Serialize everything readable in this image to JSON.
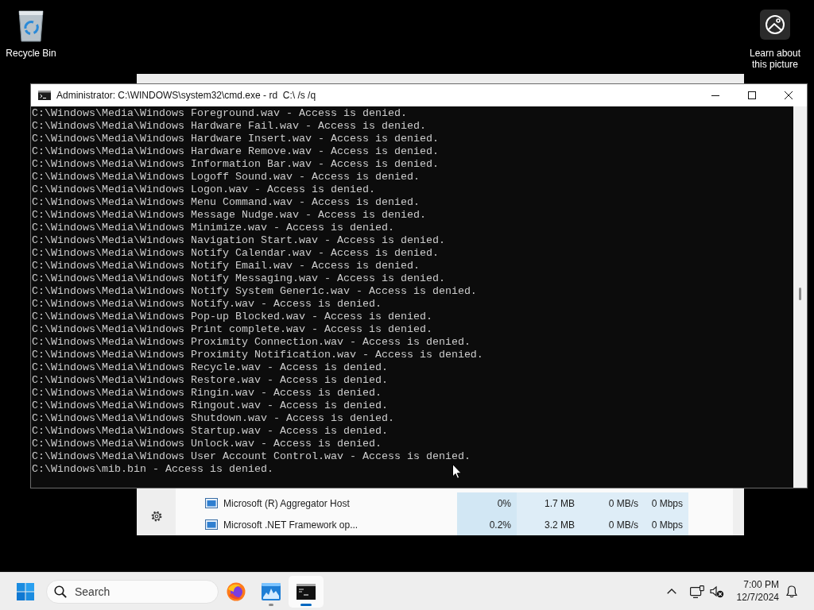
{
  "desktop_icons": [
    {
      "kind": "recycle-bin",
      "label": "Recycle Bin"
    },
    {
      "kind": "picture-info",
      "label": "Learn about this picture"
    }
  ],
  "background_window": {
    "rows": [
      {
        "cells": [
          "Microsoft (R) Aggregator Host",
          "",
          "0%",
          "1.7 MB",
          "0 MB/s",
          "0 Mbps"
        ]
      },
      {
        "cells": [
          "Microsoft .NET Framework op...",
          "",
          "0.2%",
          "3.2 MB",
          "0 MB/s",
          "0 Mbps"
        ]
      }
    ]
  },
  "console_window": {
    "title": "Administrator: C:\\WINDOWS\\system32\\cmd.exe - rd  C:\\ /s /q",
    "lines": [
      "C:\\Windows\\Media\\Windows Foreground.wav - Access is denied.",
      "C:\\Windows\\Media\\Windows Hardware Fail.wav - Access is denied.",
      "C:\\Windows\\Media\\Windows Hardware Insert.wav - Access is denied.",
      "C:\\Windows\\Media\\Windows Hardware Remove.wav - Access is denied.",
      "C:\\Windows\\Media\\Windows Information Bar.wav - Access is denied.",
      "C:\\Windows\\Media\\Windows Logoff Sound.wav - Access is denied.",
      "C:\\Windows\\Media\\Windows Logon.wav - Access is denied.",
      "C:\\Windows\\Media\\Windows Menu Command.wav - Access is denied.",
      "C:\\Windows\\Media\\Windows Message Nudge.wav - Access is denied.",
      "C:\\Windows\\Media\\Windows Minimize.wav - Access is denied.",
      "C:\\Windows\\Media\\Windows Navigation Start.wav - Access is denied.",
      "C:\\Windows\\Media\\Windows Notify Calendar.wav - Access is denied.",
      "C:\\Windows\\Media\\Windows Notify Email.wav - Access is denied.",
      "C:\\Windows\\Media\\Windows Notify Messaging.wav - Access is denied.",
      "C:\\Windows\\Media\\Windows Notify System Generic.wav - Access is denied.",
      "C:\\Windows\\Media\\Windows Notify.wav - Access is denied.",
      "C:\\Windows\\Media\\Windows Pop-up Blocked.wav - Access is denied.",
      "C:\\Windows\\Media\\Windows Print complete.wav - Access is denied.",
      "C:\\Windows\\Media\\Windows Proximity Connection.wav - Access is denied.",
      "C:\\Windows\\Media\\Windows Proximity Notification.wav - Access is denied.",
      "C:\\Windows\\Media\\Windows Recycle.wav - Access is denied.",
      "C:\\Windows\\Media\\Windows Restore.wav - Access is denied.",
      "C:\\Windows\\Media\\Windows Ringin.wav - Access is denied.",
      "C:\\Windows\\Media\\Windows Ringout.wav - Access is denied.",
      "C:\\Windows\\Media\\Windows Shutdown.wav - Access is denied.",
      "C:\\Windows\\Media\\Windows Startup.wav - Access is denied.",
      "C:\\Windows\\Media\\Windows Unlock.wav - Access is denied.",
      "C:\\Windows\\Media\\Windows User Account Control.wav - Access is denied.",
      "C:\\Windows\\mib.bin - Access is denied."
    ]
  },
  "taskbar": {
    "search": {
      "placeholder": "Search"
    },
    "apps": [
      {
        "kind": "browser",
        "open": false,
        "selected": false
      },
      {
        "kind": "monitor",
        "open": true,
        "selected": false
      },
      {
        "kind": "terminal",
        "open": true,
        "selected": true
      }
    ],
    "clock": {
      "time": "7:00 PM",
      "date": "12/7/2024"
    }
  }
}
